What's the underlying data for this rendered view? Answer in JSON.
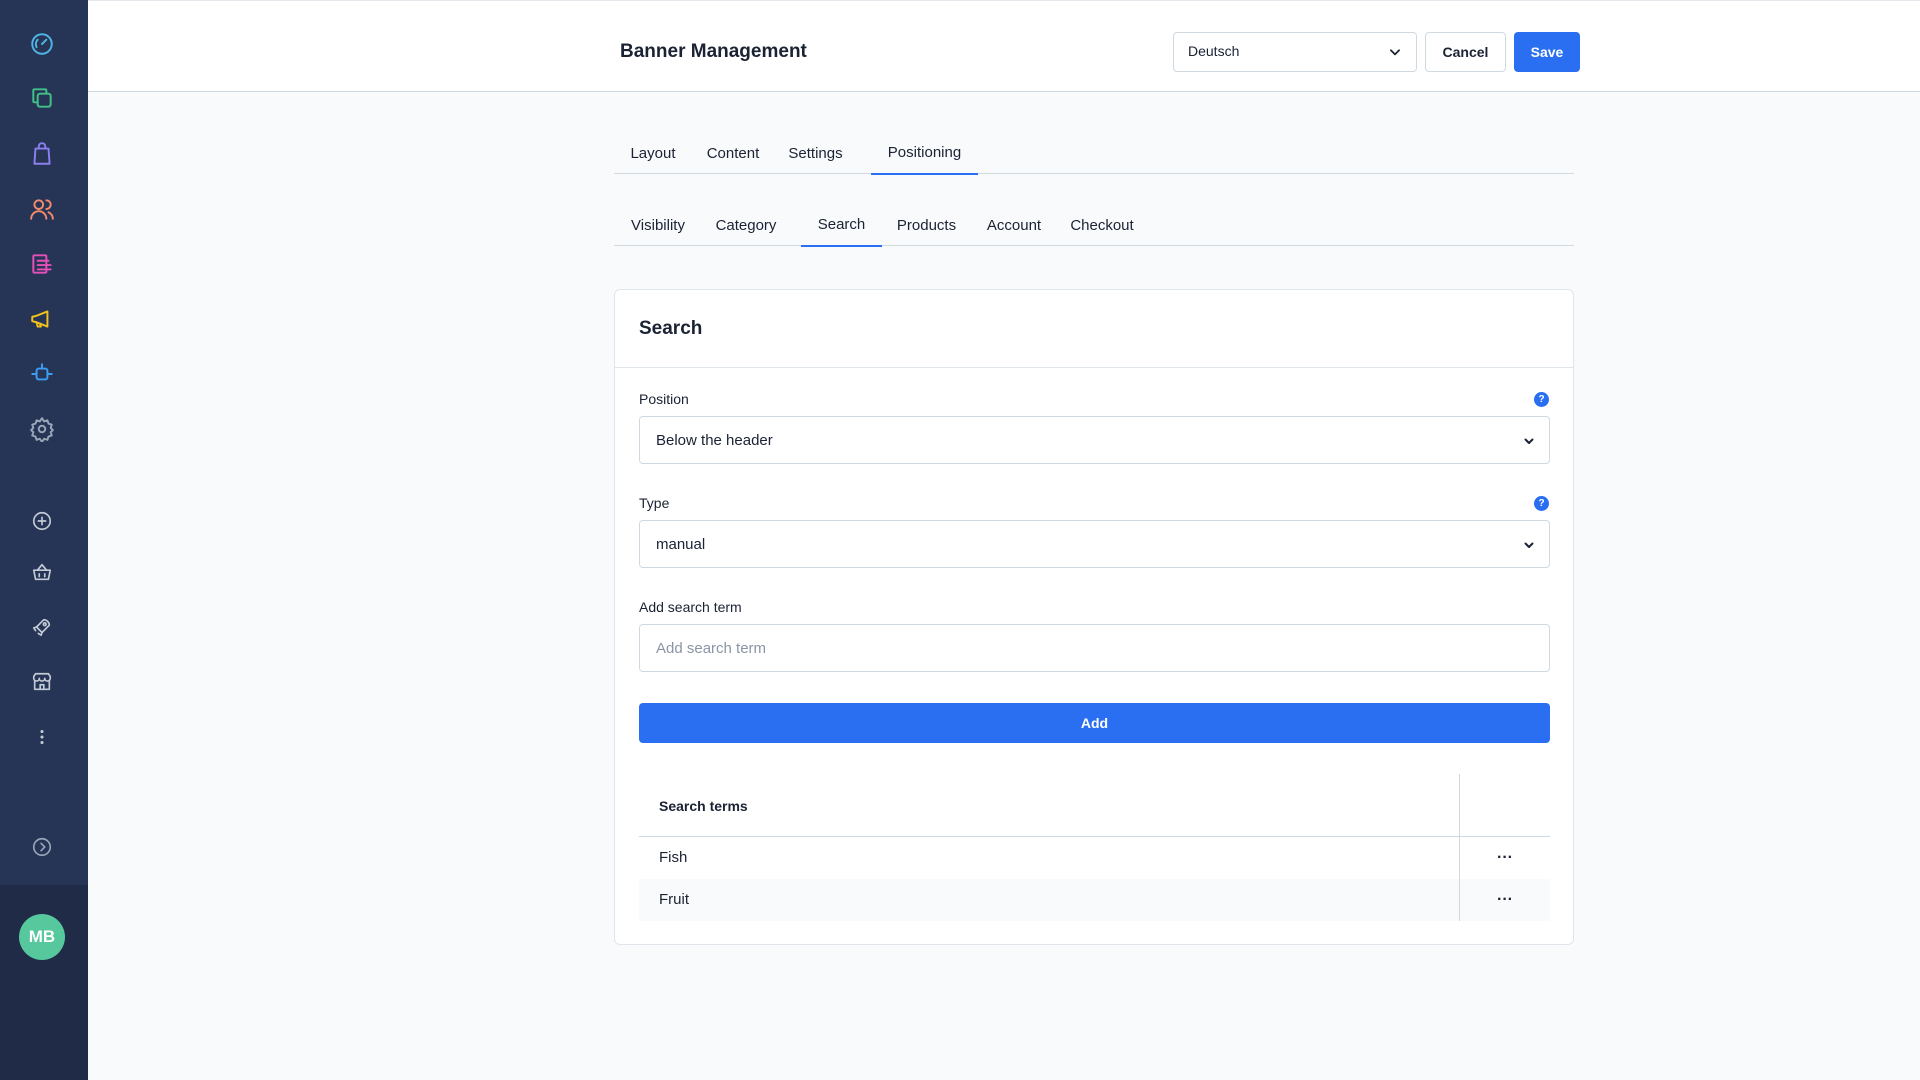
{
  "colors": {
    "sidebar_bg": "#263555",
    "accent": "#2a6ff2",
    "avatar_bg": "#57c79d"
  },
  "sidebar": {
    "icons": [
      "dashboard-icon",
      "catalogues-icon",
      "orders-icon",
      "customers-icon",
      "content-icon",
      "marketing-icon",
      "extensions-icon",
      "settings-icon",
      "add-icon",
      "basket-icon",
      "rocket-icon",
      "store-icon",
      "more-icon",
      "expand-icon"
    ],
    "avatar_initials": "MB"
  },
  "header": {
    "title": "Banner Management",
    "language": "Deutsch",
    "cancel_label": "Cancel",
    "save_label": "Save"
  },
  "tabs": {
    "main": [
      "Layout",
      "Content",
      "Settings",
      "Positioning"
    ],
    "main_active": "Positioning",
    "sub": [
      "Visibility",
      "Category",
      "Search",
      "Products",
      "Account",
      "Checkout"
    ],
    "sub_active": "Search"
  },
  "card": {
    "title": "Search",
    "position": {
      "label": "Position",
      "value": "Below the header"
    },
    "type": {
      "label": "Type",
      "value": "manual"
    },
    "search_term": {
      "label": "Add search term",
      "placeholder": "Add search term"
    },
    "add_label": "Add",
    "help_glyph": "?",
    "table": {
      "header": "Search terms",
      "menu_glyph": "···",
      "rows": [
        "Fish",
        "Fruit"
      ]
    }
  }
}
